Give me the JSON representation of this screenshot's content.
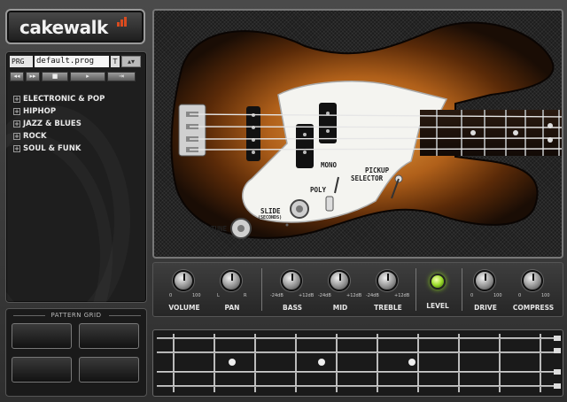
{
  "brand": {
    "logo_text": "cakewalk",
    "bar_color": "#d94b1f"
  },
  "browser": {
    "prg_button": "PRG ▸",
    "program_name": "default.prog",
    "t_button": "T",
    "transport": [
      "◂◂",
      "▸▸",
      "■",
      "▸",
      "⇥"
    ],
    "categories": [
      "ELECTRONIC & POP",
      "HIPHOP",
      "JAZZ & BLUES",
      "ROCK",
      "SOUL & FUNK"
    ]
  },
  "pattern_grid": {
    "title": "PATTERN GRID"
  },
  "bass": {
    "labels": {
      "mono": "MONO",
      "poly": "POLY",
      "pickup": "PICKUP",
      "selector": "SELECTOR",
      "slide": "SLIDE",
      "slide_sub": "(SECONDS)",
      "tune": "TUNE"
    },
    "body_colors": {
      "outer": "#1a0d05",
      "mid": "#7a3a0c",
      "center": "#e8a042"
    }
  },
  "controls": {
    "knobs": [
      {
        "label": "VOLUME",
        "min": "0",
        "max": "100"
      },
      {
        "label": "PAN",
        "min": "L",
        "max": "R"
      },
      {
        "label": "BASS",
        "min": "-24dB",
        "max": "+12dB"
      },
      {
        "label": "MID",
        "min": "-24dB",
        "max": "+12dB"
      },
      {
        "label": "TREBLE",
        "min": "-24dB",
        "max": "+12dB"
      },
      {
        "label": "LEVEL",
        "min": "",
        "max": ""
      },
      {
        "label": "DRIVE",
        "min": "0",
        "max": "100"
      },
      {
        "label": "COMPRESS",
        "min": "0",
        "max": "100"
      }
    ],
    "level_led_color": "#9bdb2a"
  },
  "fretboard": {
    "string_count": 4,
    "fret_count": 9,
    "marker_frets": [
      3,
      5,
      7
    ]
  }
}
